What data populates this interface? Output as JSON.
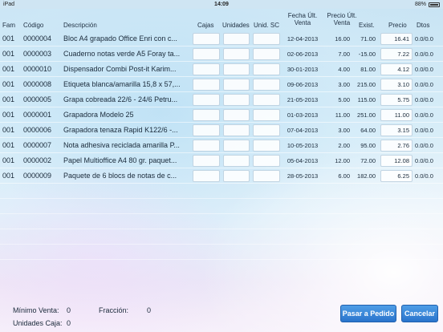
{
  "status_bar": {
    "device": "iPad",
    "time": "14:09",
    "battery": "88%"
  },
  "headers": {
    "fam": "Fam",
    "codigo": "Código",
    "descripcion": "Descripción",
    "cajas": "Cajas",
    "unidades": "Unidades",
    "unid_sc": "Unid. SC",
    "fecha_ult_venta": "Fecha Últ. Venta",
    "precio_ult_venta": "Precio Últ. Venta",
    "exist": "Exist.",
    "precio": "Precio",
    "dtos": "Dtos"
  },
  "rows": [
    {
      "fam": "001",
      "codigo": "0000004",
      "descripcion": "Bloc A4 grapado Office Enri con c...",
      "cajas": "",
      "unidades": "",
      "unid_sc": "",
      "fecha": "12-04-2013",
      "precio_ult": "16.00",
      "exist": "71.00",
      "precio": "16.41",
      "dtos": "0.0/0.0"
    },
    {
      "fam": "001",
      "codigo": "0000003",
      "descripcion": "Cuaderno notas verde A5 Foray ta...",
      "cajas": "",
      "unidades": "",
      "unid_sc": "",
      "fecha": "02-06-2013",
      "precio_ult": "7.00",
      "exist": "-15.00",
      "precio": "7.22",
      "dtos": "0.0/0.0"
    },
    {
      "fam": "001",
      "codigo": "0000010",
      "descripcion": "Dispensador Combi Post-it Karim...",
      "cajas": "",
      "unidades": "",
      "unid_sc": "",
      "fecha": "30-01-2013",
      "precio_ult": "4.00",
      "exist": "81.00",
      "precio": "4.12",
      "dtos": "0.0/0.0"
    },
    {
      "fam": "001",
      "codigo": "0000008",
      "descripcion": "Etiqueta blanca/amarilla 15,8 x 57,...",
      "cajas": "",
      "unidades": "",
      "unid_sc": "",
      "fecha": "09-06-2013",
      "precio_ult": "3.00",
      "exist": "215.00",
      "precio": "3.10",
      "dtos": "0.0/0.0"
    },
    {
      "fam": "001",
      "codigo": "0000005",
      "descripcion": "Grapa cobreada 22/6 - 24/6 Petru...",
      "cajas": "",
      "unidades": "",
      "unid_sc": "",
      "fecha": "21-05-2013",
      "precio_ult": "5.00",
      "exist": "115.00",
      "precio": "5.75",
      "dtos": "0.0/0.0"
    },
    {
      "fam": "001",
      "codigo": "0000001",
      "descripcion": "Grapadora Modelo 25",
      "cajas": "",
      "unidades": "",
      "unid_sc": "",
      "fecha": "01-03-2013",
      "precio_ult": "11.00",
      "exist": "251.00",
      "precio": "11.00",
      "dtos": "0.0/0.0"
    },
    {
      "fam": "001",
      "codigo": "0000006",
      "descripcion": "Grapadora tenaza Rapid K122/6 -...",
      "cajas": "",
      "unidades": "",
      "unid_sc": "",
      "fecha": "07-04-2013",
      "precio_ult": "3.00",
      "exist": "64.00",
      "precio": "3.15",
      "dtos": "0.0/0.0"
    },
    {
      "fam": "001",
      "codigo": "0000007",
      "descripcion": "Nota adhesiva reciclada amarilla P...",
      "cajas": "",
      "unidades": "",
      "unid_sc": "",
      "fecha": "10-05-2013",
      "precio_ult": "2.00",
      "exist": "95.00",
      "precio": "2.76",
      "dtos": "0.0/0.0"
    },
    {
      "fam": "001",
      "codigo": "0000002",
      "descripcion": "Papel Multioffice A4 80 gr. paquet...",
      "cajas": "",
      "unidades": "",
      "unid_sc": "",
      "fecha": "05-04-2013",
      "precio_ult": "12.00",
      "exist": "72.00",
      "precio": "12.08",
      "dtos": "0.0/0.0"
    },
    {
      "fam": "001",
      "codigo": "0000009",
      "descripcion": "Paquete de 6 blocs de notas de c...",
      "cajas": "",
      "unidades": "",
      "unid_sc": "",
      "fecha": "28-05-2013",
      "precio_ult": "6.00",
      "exist": "182.00",
      "precio": "6.25",
      "dtos": "0.0/0.0"
    }
  ],
  "footer": {
    "minimo_venta_label": "Mínimo Venta:",
    "minimo_venta_value": "0",
    "fraccion_label": "Fracción:",
    "fraccion_value": "0",
    "unidades_caja_label": "Unidades Caja:",
    "unidades_caja_value": "0",
    "pasar_button": "Pasar a Pedido",
    "cancelar_button": "Cancelar"
  },
  "colors": {
    "button_blue": "#2a74cc",
    "background": "#c7e3f3"
  }
}
